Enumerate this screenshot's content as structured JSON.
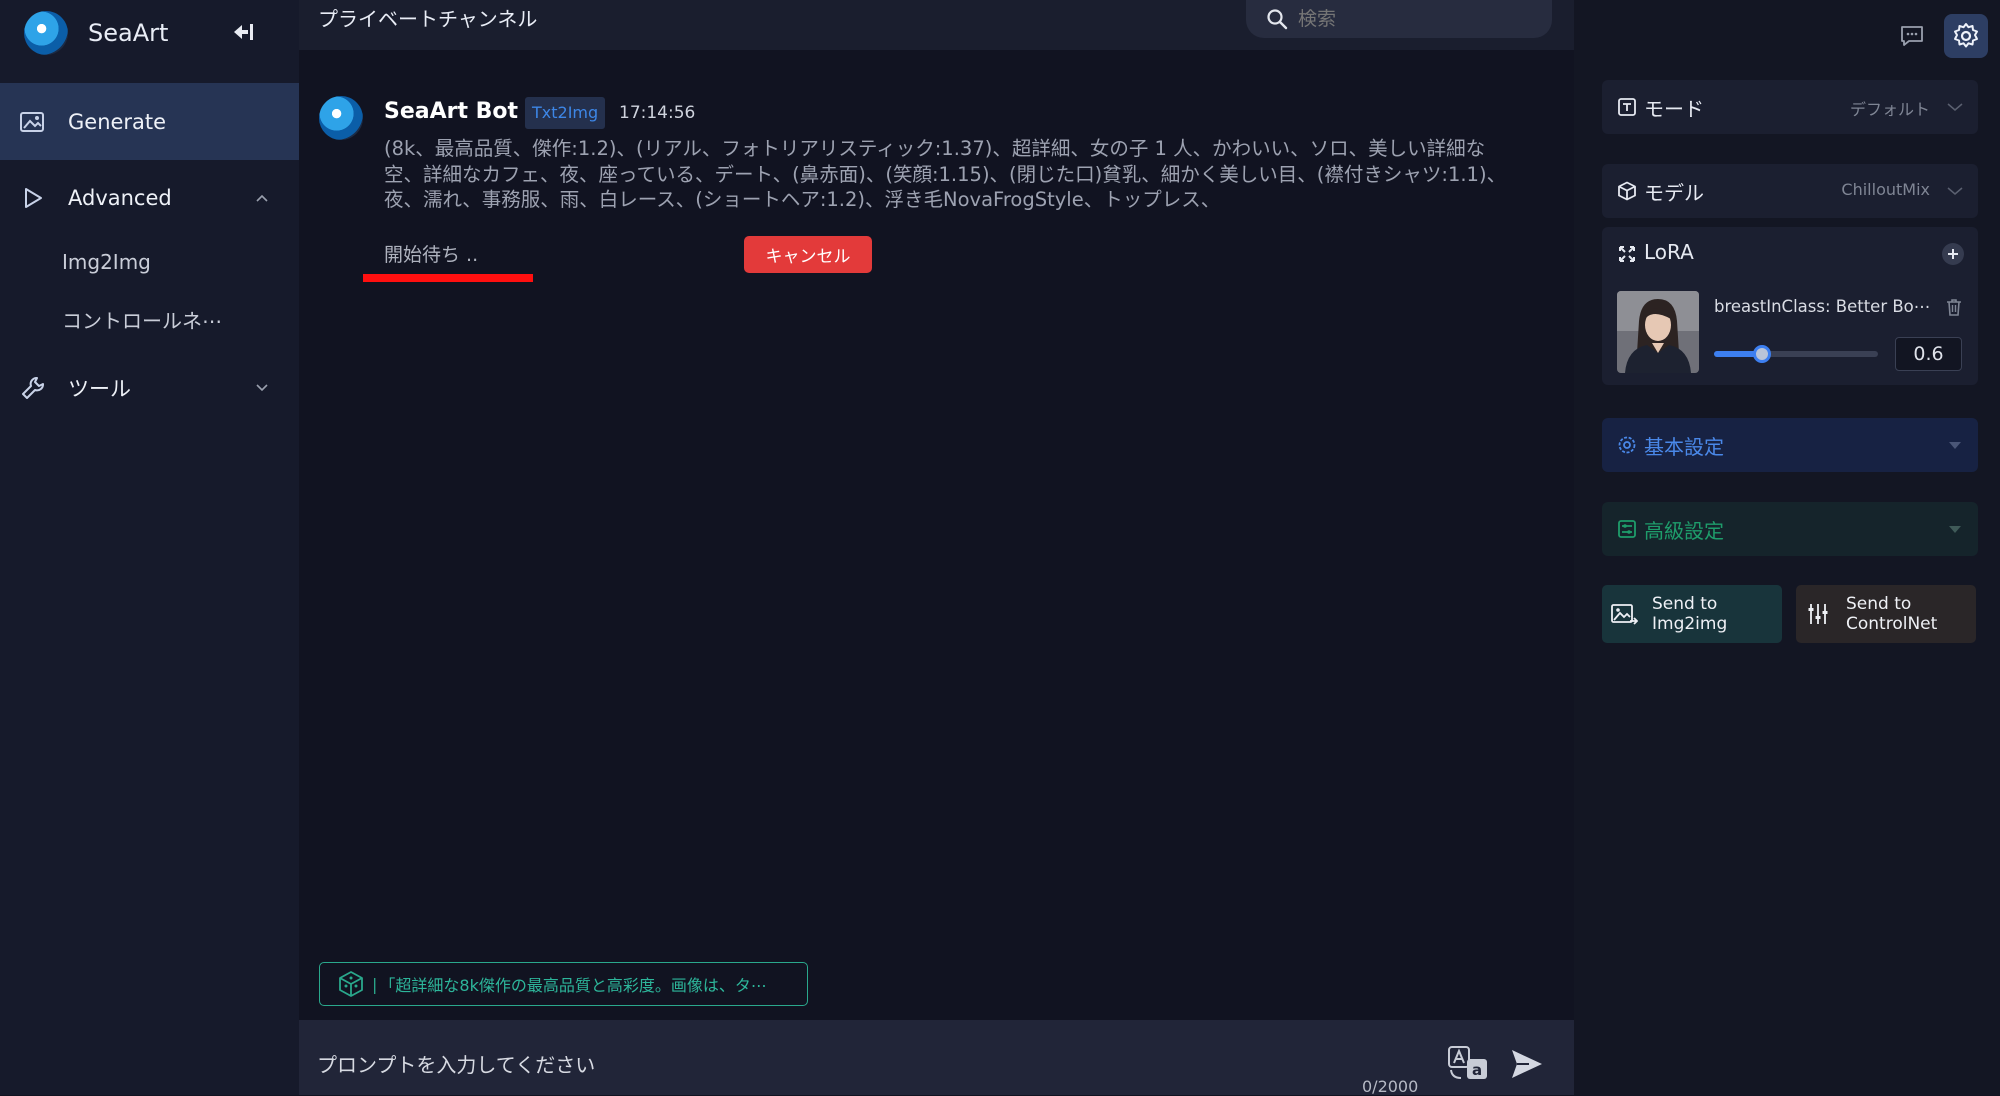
{
  "sidebar": {
    "brand": "SeaArt",
    "nav": {
      "generate": "Generate",
      "advanced": "Advanced",
      "img2img": "Img2Img",
      "controlnet": "コントロールネ⋯",
      "tools": "ツール"
    }
  },
  "header": {
    "channel_title": "プライベートチャンネル",
    "search_placeholder": "検索"
  },
  "message": {
    "sender": "SeaArt Bot",
    "tag": "Txt2Img",
    "time": "17:14:56",
    "prompt": "(8k、最高品質、傑作:1.2)、(リアル、フォトリアリスティック:1.37)、超詳細、女の子 1 人、かわいい、ソロ、美しい詳細な空、詳細なカフェ、夜、座っている、デート、(鼻赤面)、(笑顔:1.15)、(閉じた口)貧乳、細かく美しい目、(襟付きシャツ:1.1)、夜、濡れ、事務服、雨、白レース、(ショートヘア:1.2)、浮き毛NovaFrogStyle、トップレス、",
    "status": "開始待ち ..",
    "cancel_label": "キャンセル"
  },
  "suggestion": {
    "separator": "|",
    "text": "「超詳細な8k傑作の最高品質と高彩度。画像は、タ⋯"
  },
  "input": {
    "placeholder": "プロンプトを入力してください",
    "char_count": "0/2000"
  },
  "settings": {
    "mode": {
      "label": "モード",
      "value": "デフォルト"
    },
    "model": {
      "label": "モデル",
      "value": "ChilloutMix"
    },
    "lora": {
      "label": "LoRA",
      "item_name": "breastInClass: Better Bo⋯",
      "weight": "0.6",
      "slider_fraction": 0.29
    },
    "basic_label": "基本設定",
    "advanced_label": "高級設定",
    "send_img2img": "Send to Img2img",
    "send_controlnet": "Send to ControlNet"
  },
  "colors": {
    "accent": "#3d7ff0",
    "cancel": "#e33a3a",
    "suggest": "#2aa88c",
    "advanced_green": "#1e9d6b",
    "basic_blue": "#4a88e8"
  },
  "icons": {
    "collapse": "arrow-left-bar-icon",
    "generate": "image-edit-icon",
    "advanced": "play-triangle-icon",
    "tools": "wrench-icon",
    "search": "search-icon",
    "chat": "chat-icon",
    "settings": "gear-icon",
    "translate": "translate-icon",
    "send": "send-icon"
  }
}
